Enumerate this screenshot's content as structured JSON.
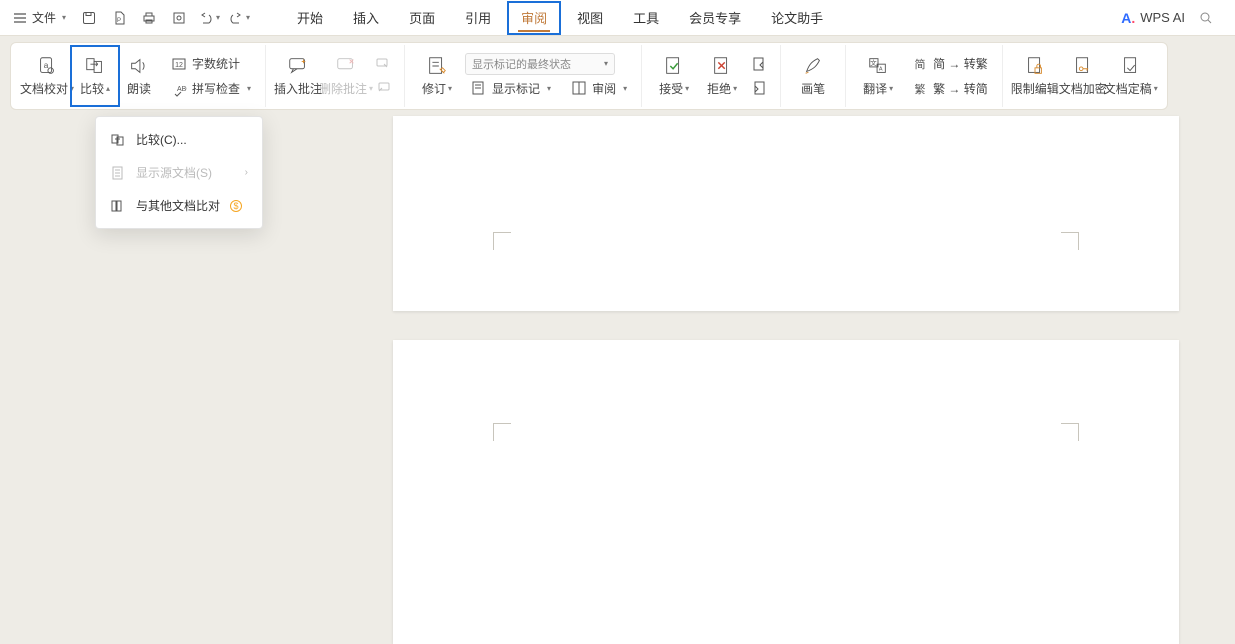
{
  "menubar": {
    "file_label": "文件",
    "tabs": [
      "开始",
      "插入",
      "页面",
      "引用",
      "审阅",
      "视图",
      "工具",
      "会员专享",
      "论文助手"
    ],
    "active_tab_index": 4,
    "wps_ai_label": "WPS AI"
  },
  "ribbon": {
    "proofread": "文档校对",
    "compare": "比较",
    "read_aloud": "朗读",
    "word_count": "字数统计",
    "spell_check": "拼写检查",
    "insert_comment": "插入批注",
    "delete_comment": "删除批注",
    "track_changes": "修订",
    "markup_display_mode": "显示标记的最终状态",
    "show_markup": "显示标记",
    "review_pane": "审阅",
    "accept": "接受",
    "reject": "拒绝",
    "ink": "画笔",
    "translate": "翻译",
    "simp_to_trad": "简 → 转繁",
    "trad_to_simp": "繁 → 转简",
    "restrict_edit": "限制编辑",
    "encrypt_doc": "文档加密",
    "finalize_doc": "文档定稿"
  },
  "compare_menu": {
    "compare_item": "比较(C)...",
    "show_source": "显示源文档(S)",
    "compare_other": "与其他文档比对"
  }
}
